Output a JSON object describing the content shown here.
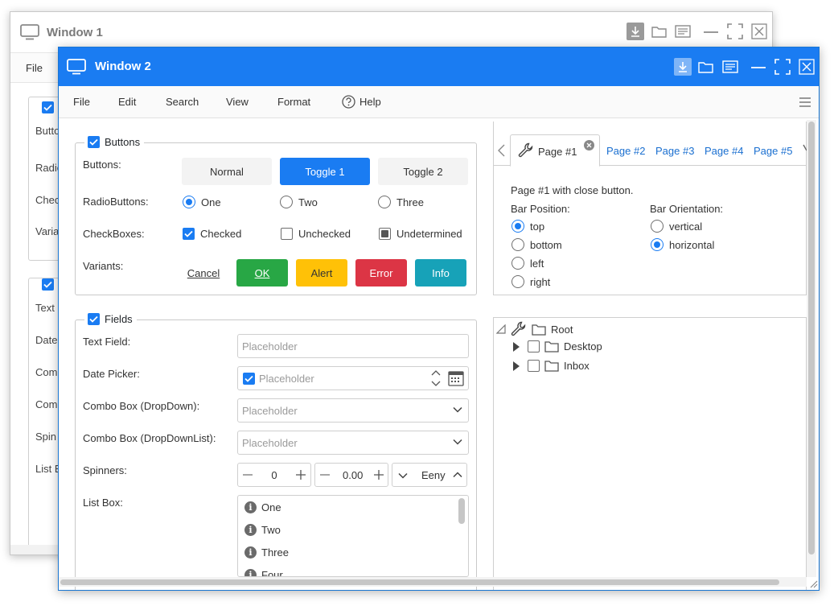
{
  "window1": {
    "title": "Window 1",
    "menu": {
      "file": "File"
    },
    "labels": [
      "Butto",
      "Radio",
      "Chec",
      "Varia",
      "Text",
      "Date",
      "Com",
      "Com",
      "Spin",
      "List B"
    ]
  },
  "window2": {
    "title": "Window 2",
    "menu": [
      "File",
      "Edit",
      "Search",
      "View",
      "Format",
      "Help"
    ],
    "buttons_group": {
      "legend": "Buttons",
      "row_labels": {
        "buttons": "Buttons:",
        "radio": "RadioButtons:",
        "checkboxes": "CheckBoxes:",
        "variants": "Variants:"
      },
      "buttons": [
        {
          "label": "Normal",
          "state": "normal"
        },
        {
          "label": "Toggle 1",
          "state": "on"
        },
        {
          "label": "Toggle 2",
          "state": "off"
        }
      ],
      "radios": [
        {
          "label": "One",
          "checked": true
        },
        {
          "label": "Two",
          "checked": false
        },
        {
          "label": "Three",
          "checked": false
        }
      ],
      "checkboxes": [
        {
          "label": "Checked",
          "state": "checked"
        },
        {
          "label": "Unchecked",
          "state": "unchecked"
        },
        {
          "label": "Undetermined",
          "state": "undetermined"
        }
      ],
      "variants": [
        {
          "label": "Cancel",
          "color": ""
        },
        {
          "label": "OK",
          "color": "#28a745"
        },
        {
          "label": "Alert",
          "color": "#ffc107"
        },
        {
          "label": "Error",
          "color": "#dc3545"
        },
        {
          "label": "Info",
          "color": "#17a2b8"
        }
      ]
    },
    "fields_group": {
      "legend": "Fields",
      "row_labels": {
        "text": "Text Field:",
        "date": "Date Picker:",
        "combo1": "Combo Box (DropDown):",
        "combo2": "Combo Box (DropDownList):",
        "spinners": "Spinners:",
        "listbox": "List Box:"
      },
      "text_placeholder": "Placeholder",
      "date_placeholder": "Placeholder",
      "combo1_placeholder": "Placeholder",
      "combo2_placeholder": "Placeholder",
      "spinners": {
        "int_value": "0",
        "dec_value": "0.00",
        "text_value": "Eeny"
      },
      "list_items": [
        "One",
        "Two",
        "Three",
        "Four"
      ]
    },
    "tabs": {
      "items": [
        "Page #1",
        "Page #2",
        "Page #3",
        "Page #4",
        "Page #5"
      ],
      "active": "Page #1",
      "content_text": "Page #1 with close button.",
      "bar_position_label": "Bar Position:",
      "bar_position_options": [
        {
          "label": "top",
          "checked": true
        },
        {
          "label": "bottom",
          "checked": false
        },
        {
          "label": "left",
          "checked": false
        },
        {
          "label": "right",
          "checked": false
        }
      ],
      "bar_orientation_label": "Bar Orientation:",
      "bar_orientation_options": [
        {
          "label": "vertical",
          "checked": false
        },
        {
          "label": "horizontal",
          "checked": true
        }
      ]
    },
    "tree": {
      "root": "Root",
      "children": [
        "Desktop",
        "Inbox"
      ]
    },
    "colors": {
      "accent": "#1a7cf2",
      "titlebar": "#1a7cf2"
    }
  }
}
